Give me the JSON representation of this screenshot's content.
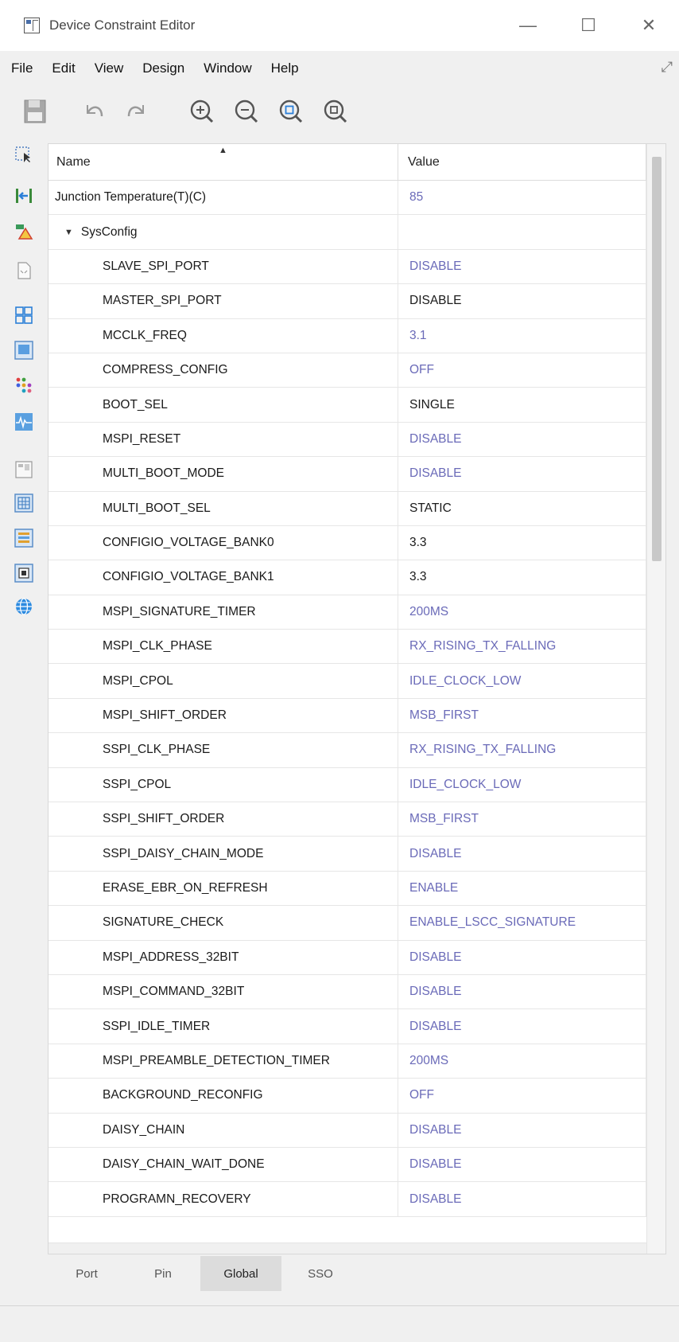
{
  "window": {
    "title": "Device Constraint Editor",
    "minimize": "—",
    "maximize": "☐",
    "close": "✕"
  },
  "menu": {
    "items": [
      "File",
      "Edit",
      "View",
      "Design",
      "Window",
      "Help"
    ]
  },
  "table": {
    "columns": {
      "name": "Name",
      "value": "Value"
    },
    "rows": [
      {
        "name": "Junction Temperature(T)(C)",
        "value": "85",
        "level": 0,
        "default": true
      },
      {
        "name": "SysConfig",
        "value": "",
        "level": 1,
        "default": false,
        "group": true
      },
      {
        "name": "SLAVE_SPI_PORT",
        "value": "DISABLE",
        "level": 2,
        "default": true
      },
      {
        "name": "MASTER_SPI_PORT",
        "value": "DISABLE",
        "level": 2,
        "default": false
      },
      {
        "name": "MCCLK_FREQ",
        "value": "3.1",
        "level": 2,
        "default": true
      },
      {
        "name": "COMPRESS_CONFIG",
        "value": "OFF",
        "level": 2,
        "default": true
      },
      {
        "name": "BOOT_SEL",
        "value": "SINGLE",
        "level": 2,
        "default": false
      },
      {
        "name": "MSPI_RESET",
        "value": "DISABLE",
        "level": 2,
        "default": true
      },
      {
        "name": "MULTI_BOOT_MODE",
        "value": "DISABLE",
        "level": 2,
        "default": true
      },
      {
        "name": "MULTI_BOOT_SEL",
        "value": "STATIC",
        "level": 2,
        "default": false
      },
      {
        "name": "CONFIGIO_VOLTAGE_BANK0",
        "value": "3.3",
        "level": 2,
        "default": false
      },
      {
        "name": "CONFIGIO_VOLTAGE_BANK1",
        "value": "3.3",
        "level": 2,
        "default": false
      },
      {
        "name": "MSPI_SIGNATURE_TIMER",
        "value": "200MS",
        "level": 2,
        "default": true
      },
      {
        "name": "MSPI_CLK_PHASE",
        "value": "RX_RISING_TX_FALLING",
        "level": 2,
        "default": true
      },
      {
        "name": "MSPI_CPOL",
        "value": "IDLE_CLOCK_LOW",
        "level": 2,
        "default": true
      },
      {
        "name": "MSPI_SHIFT_ORDER",
        "value": "MSB_FIRST",
        "level": 2,
        "default": true
      },
      {
        "name": "SSPI_CLK_PHASE",
        "value": "RX_RISING_TX_FALLING",
        "level": 2,
        "default": true
      },
      {
        "name": "SSPI_CPOL",
        "value": "IDLE_CLOCK_LOW",
        "level": 2,
        "default": true
      },
      {
        "name": "SSPI_SHIFT_ORDER",
        "value": "MSB_FIRST",
        "level": 2,
        "default": true
      },
      {
        "name": "SSPI_DAISY_CHAIN_MODE",
        "value": "DISABLE",
        "level": 2,
        "default": true
      },
      {
        "name": "ERASE_EBR_ON_REFRESH",
        "value": "ENABLE",
        "level": 2,
        "default": true
      },
      {
        "name": "SIGNATURE_CHECK",
        "value": "ENABLE_LSCC_SIGNATURE",
        "level": 2,
        "default": true
      },
      {
        "name": "MSPI_ADDRESS_32BIT",
        "value": "DISABLE",
        "level": 2,
        "default": true
      },
      {
        "name": "MSPI_COMMAND_32BIT",
        "value": "DISABLE",
        "level": 2,
        "default": true
      },
      {
        "name": "SSPI_IDLE_TIMER",
        "value": "DISABLE",
        "level": 2,
        "default": true
      },
      {
        "name": "MSPI_PREAMBLE_DETECTION_TIMER",
        "value": "200MS",
        "level": 2,
        "default": true
      },
      {
        "name": "BACKGROUND_RECONFIG",
        "value": "OFF",
        "level": 2,
        "default": true
      },
      {
        "name": "DAISY_CHAIN",
        "value": "DISABLE",
        "level": 2,
        "default": true
      },
      {
        "name": "DAISY_CHAIN_WAIT_DONE",
        "value": "DISABLE",
        "level": 2,
        "default": true
      },
      {
        "name": "PROGRAMN_RECOVERY",
        "value": "DISABLE",
        "level": 2,
        "default": true
      }
    ]
  },
  "tabs": [
    {
      "label": "Port",
      "active": false
    },
    {
      "label": "Pin",
      "active": false
    },
    {
      "label": "Global",
      "active": true
    },
    {
      "label": "SSO",
      "active": false
    }
  ],
  "colors": {
    "default_value": "#6a6ab8",
    "set_value": "#1a1a1a",
    "accent": "#2b7fd8"
  },
  "toolbar": {
    "icons": [
      "save-icon",
      "undo-icon",
      "redo-icon",
      "zoom-in-icon",
      "zoom-out-icon",
      "zoom-fit-icon",
      "zoom-selection-icon"
    ]
  },
  "left_toolbar": {
    "icons": [
      "select-icon",
      "import-icon",
      "drc-warning-icon",
      "file-icon",
      "grid-view-icon",
      "panel-icon",
      "palette-icon",
      "waveform-icon",
      "device-view-icon",
      "table-icon",
      "list-icon",
      "package-icon",
      "globe-icon"
    ]
  }
}
